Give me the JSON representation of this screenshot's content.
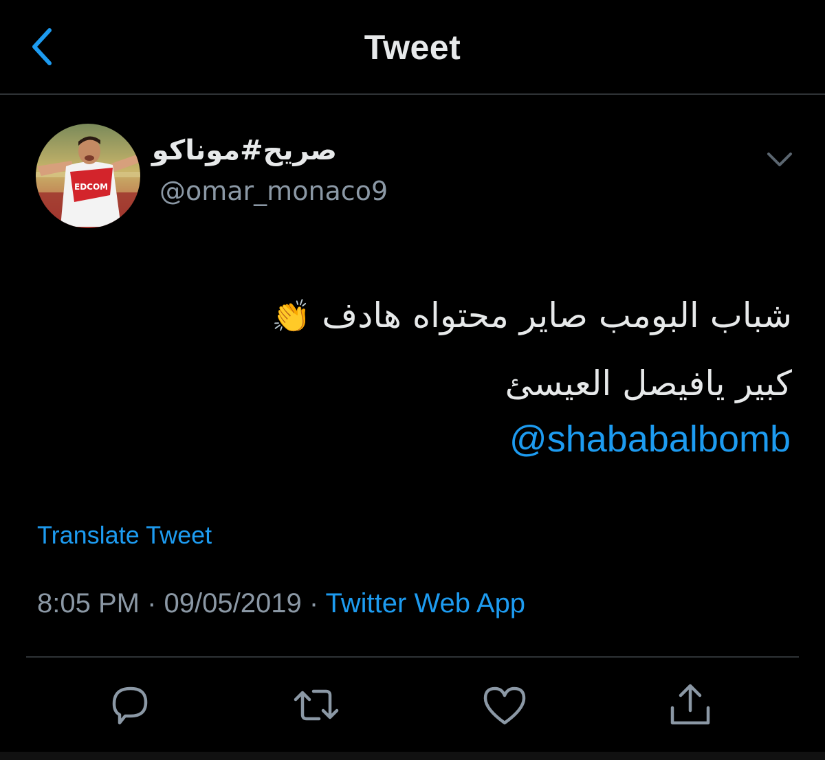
{
  "header": {
    "title": "Tweet",
    "back_icon": "chevron-left-icon"
  },
  "author": {
    "display_name": "صريح#موناكو",
    "handle": "@omar_monaco9",
    "avatar_icon": "avatar-photo"
  },
  "tweet": {
    "lines": [
      "شباب البومب صاير محتواه هادف",
      "كبير يافيصل العيسئ"
    ],
    "emoji": "👏",
    "mention": "@shababalbomb",
    "translate_label": "Translate Tweet",
    "time": "8:05 PM",
    "separator": " · ",
    "date": "09/05/2019",
    "source": "Twitter Web App"
  },
  "actions": [
    "reply-icon",
    "retweet-icon",
    "like-icon",
    "share-icon"
  ],
  "colors": {
    "background": "#000000",
    "accent": "#1d9bf0",
    "secondary_text": "#8b98a5",
    "divider": "#2f3336"
  }
}
